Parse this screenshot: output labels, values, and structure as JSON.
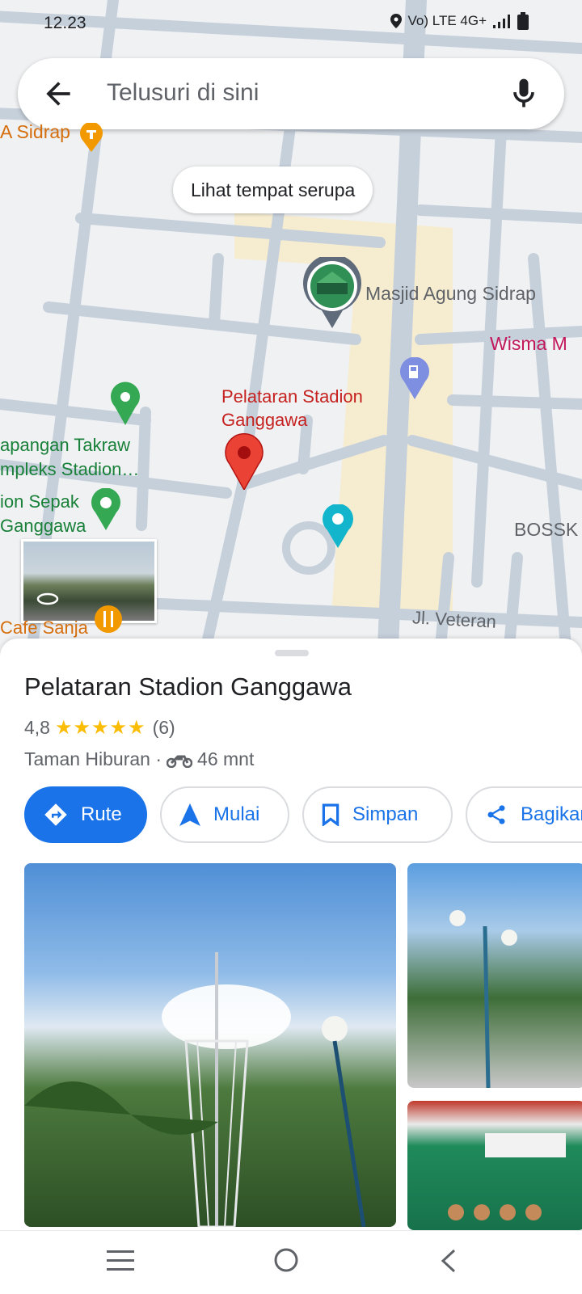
{
  "status_bar": {
    "time": "12.23",
    "network": "Vo) LTE 4G+"
  },
  "search": {
    "placeholder": "Telusuri di sini"
  },
  "map": {
    "similar_places_label": "Lihat tempat serupa",
    "labels": {
      "sidrap": "A Sidrap",
      "masjid": "Masjid Agung Sidrap",
      "wisma": "Wisma M",
      "selected_place": "Pelataran Stadion Ganggawa",
      "takraw": "apangan Takraw mpleks Stadion…",
      "sepak": "ion Sepak Ganggawa",
      "bossk": "BOSSK",
      "cafe": "Cafe Sanja",
      "street": "Jl. Veteran"
    }
  },
  "place": {
    "name": "Pelataran Stadion Ganggawa",
    "rating": "4,8",
    "stars": "★★★★★",
    "review_count": "(6)",
    "category": "Taman Hiburan ·",
    "travel_time": "46 mnt"
  },
  "actions": {
    "route": "Rute",
    "start": "Mulai",
    "save": "Simpan",
    "share": "Bagikan"
  },
  "colors": {
    "accent": "#1a73e8",
    "pin_red": "#ea4335",
    "star": "#fbbc04"
  }
}
